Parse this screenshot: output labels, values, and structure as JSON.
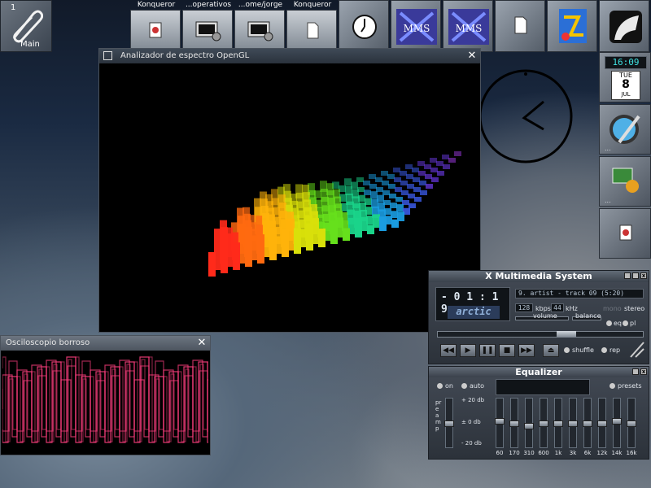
{
  "launcher": {
    "number": "1",
    "label": "Main"
  },
  "taskbar": [
    {
      "title": "Konqueror",
      "icon": "konqueror-icon"
    },
    {
      "title": "...operativos",
      "icon": "terminal-icon"
    },
    {
      "title": "...ome/jorge",
      "icon": "terminal-icon"
    },
    {
      "title": "Konqueror",
      "icon": "konqueror-icon"
    }
  ],
  "top_tiles": [
    "clock-icon",
    "xmms-icon",
    "xmms-icon",
    "document-icon",
    "kde-icon",
    "gimp-icon"
  ],
  "dock": {
    "time": "16:09",
    "day": "TUE",
    "date": "8",
    "month": "JUL",
    "dots": "..."
  },
  "spectrum_window": {
    "title": "Analizador de espectro OpenGL"
  },
  "scope_window": {
    "title": "Osciloscopio borroso"
  },
  "xmms": {
    "title": "X Multimedia System",
    "time": "- 0 1 : 1 9",
    "track": "9. artist - track 09 (5:20)",
    "kbps": "128",
    "kbps_label": "kbps",
    "khz": "44",
    "khz_label": "kHz",
    "mono_label": "mono",
    "stereo_label": "stereo",
    "volume_label": "volume",
    "balance_label": "balance",
    "eq_label": "eq",
    "pl_label": "pl",
    "visual_text": "arctic",
    "shuffle_label": "shuffle",
    "rep_label": "rep"
  },
  "equalizer": {
    "title": "Equalizer",
    "on_label": "on",
    "auto_label": "auto",
    "presets_label": "presets",
    "preamp_label": "preamp",
    "db_top": "+ 20 db",
    "db_mid": "± 0 db",
    "db_bottom": "- 20 db",
    "bands": [
      "60",
      "170",
      "310",
      "600",
      "1k",
      "3k",
      "6k",
      "12k",
      "14k",
      "16k"
    ],
    "levels": [
      0.55,
      0.5,
      0.45,
      0.5,
      0.5,
      0.5,
      0.5,
      0.5,
      0.55,
      0.5
    ],
    "preamp_level": 0.5
  },
  "spectrum_colors": [
    "#ff2a1a",
    "#ff6a10",
    "#ffb30a",
    "#d9e00a",
    "#66e01c",
    "#1ad48a",
    "#1a9ce0",
    "#3a5ae6",
    "#6b3ae6",
    "#9b3ae0"
  ],
  "scope_color": "#ff3f7f"
}
